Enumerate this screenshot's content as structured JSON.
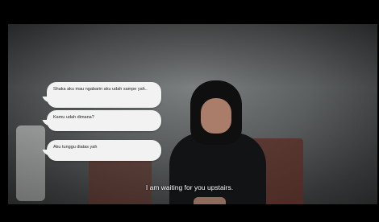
{
  "messages": [
    {
      "text": "Shaka aku mau ngabarin aku udah sampe yah.."
    },
    {
      "text": "Kamu udah dimana?"
    },
    {
      "text": "Aku tunggu diatas yah"
    }
  ],
  "subtitle": "I am waiting for you upstairs."
}
